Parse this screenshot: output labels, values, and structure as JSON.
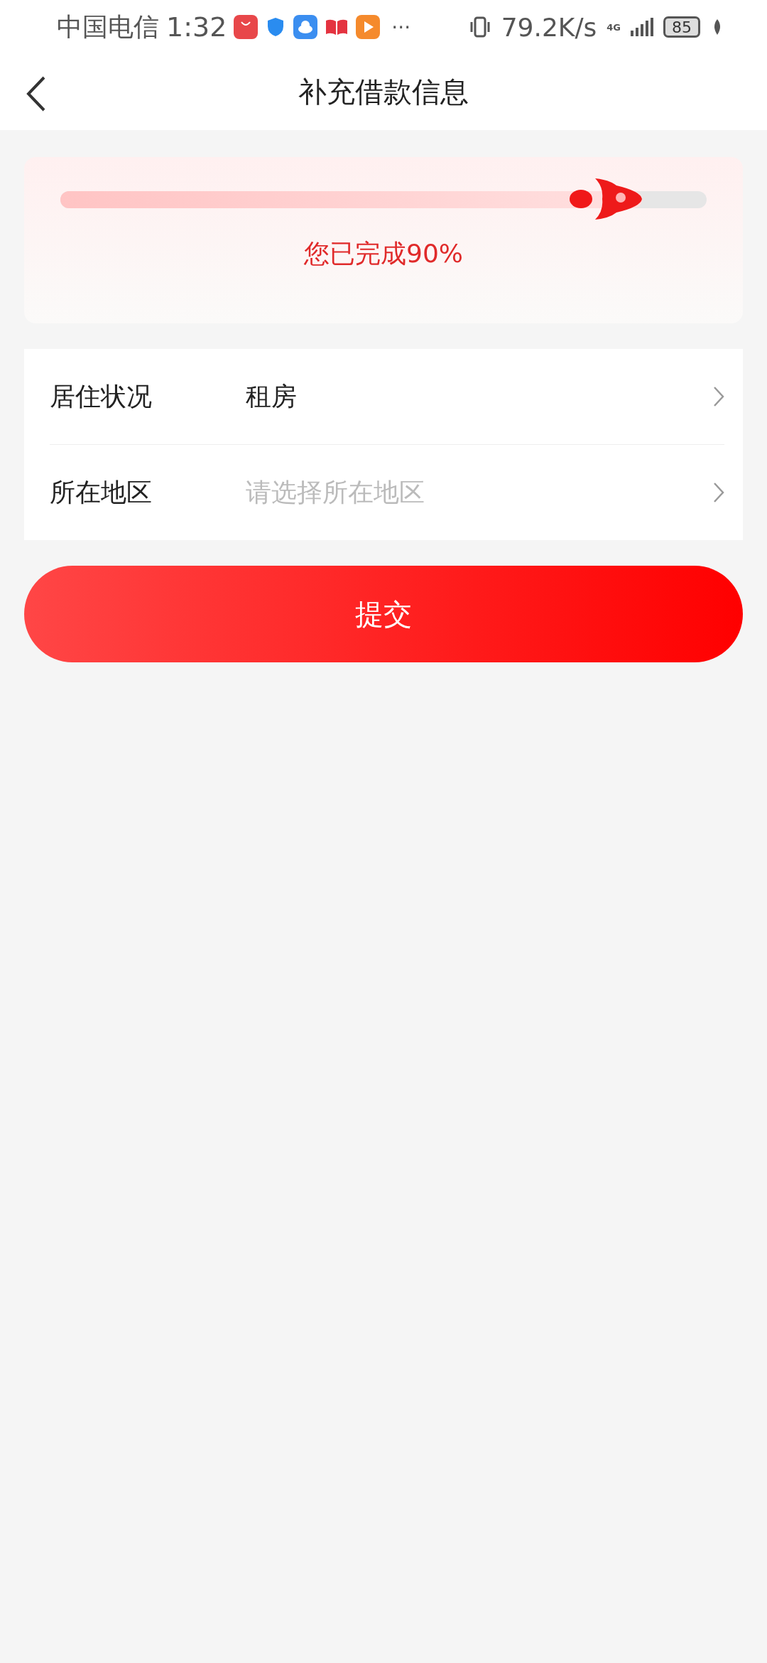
{
  "status_bar": {
    "carrier": "中国电信",
    "time": "1:32",
    "more": "···",
    "speed": "79.2K/s",
    "network": "4G",
    "battery": "85"
  },
  "header": {
    "title": "补充借款信息"
  },
  "progress": {
    "level": 0.9,
    "text": "您已完成90%"
  },
  "form": [
    {
      "label": "居住状况",
      "value": "租房"
    },
    {
      "label": "所在地区",
      "placeholder": "请选择所在地区"
    }
  ],
  "submit": {
    "label": "提交"
  }
}
